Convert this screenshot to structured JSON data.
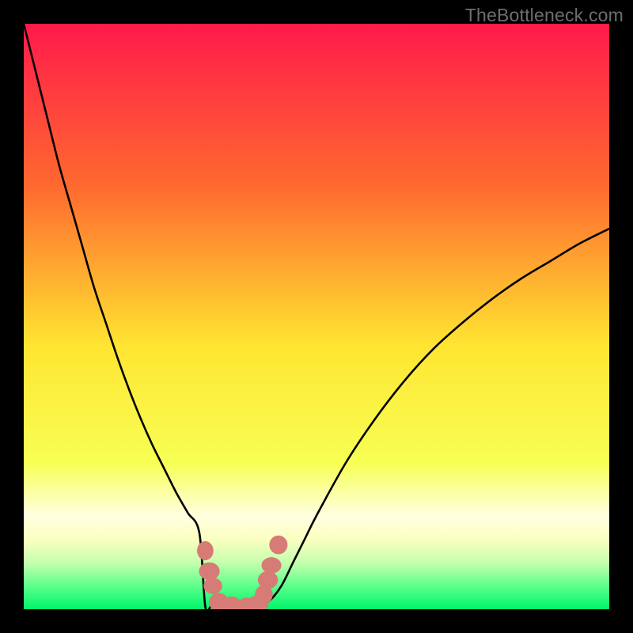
{
  "watermark": "TheBottleneck.com",
  "colors": {
    "frame": "#000000",
    "gradient_top": "#ff1a4b",
    "gradient_upper_mid": "#ff8a2a",
    "gradient_mid": "#ffe531",
    "gradient_lower_mid": "#f7ff55",
    "gradient_band_pale": "#ffffe0",
    "gradient_band_green_pale": "#9dffb3",
    "gradient_green": "#00f56a",
    "curve": "#000000",
    "marker_fill": "#d77b77",
    "marker_stroke": "#c96a66",
    "watermark_text": "#6e6e6e"
  },
  "chart_data": {
    "type": "line",
    "title": "",
    "xlabel": "",
    "ylabel": "",
    "xlim": [
      0,
      100
    ],
    "ylim": [
      0,
      100
    ],
    "axes_visible": false,
    "grid": false,
    "x": [
      0,
      2,
      4,
      6,
      8,
      10,
      12,
      14,
      16,
      18,
      20,
      22,
      24,
      26,
      28,
      30,
      31,
      32,
      33,
      34,
      35,
      36,
      37,
      38,
      39,
      40,
      42,
      44,
      46,
      48,
      50,
      55,
      60,
      65,
      70,
      75,
      80,
      85,
      90,
      95,
      100
    ],
    "series": [
      {
        "name": "bottleneck-curve",
        "values": [
          100,
          92,
          84,
          76,
          69,
          62,
          55,
          49,
          43,
          37.5,
          32.5,
          28,
          24,
          20,
          16.5,
          13,
          11.5,
          10,
          8.5,
          7,
          5.5,
          4,
          3,
          2,
          1.2,
          0.7,
          1.5,
          4,
          8,
          12,
          16,
          25,
          32.5,
          39,
          44.5,
          49,
          53,
          56.5,
          59.5,
          62.5,
          65
        ]
      }
    ],
    "flat_band": {
      "x_range": [
        31,
        41
      ],
      "y": 0.5
    },
    "markers": [
      {
        "x": 31.0,
        "y": 10.0
      },
      {
        "x": 31.7,
        "y": 6.5
      },
      {
        "x": 32.3,
        "y": 4.0
      },
      {
        "x": 33.3,
        "y": 1.2
      },
      {
        "x": 35.5,
        "y": 0.6
      },
      {
        "x": 38.0,
        "y": 0.6
      },
      {
        "x": 40.0,
        "y": 0.9
      },
      {
        "x": 41.0,
        "y": 2.5
      },
      {
        "x": 41.7,
        "y": 5.0
      },
      {
        "x": 42.3,
        "y": 7.5
      },
      {
        "x": 43.5,
        "y": 11.0
      }
    ]
  }
}
